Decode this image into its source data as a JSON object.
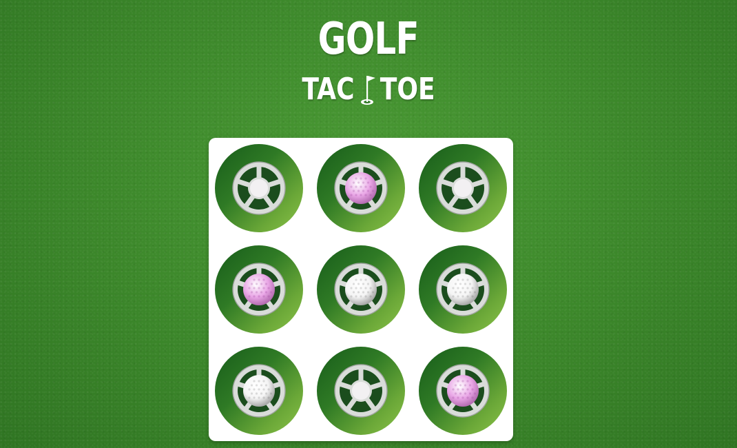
{
  "title": {
    "line1": "GOLF",
    "line2_left": "TAC",
    "line2_right": "TOE"
  },
  "icons": {
    "flag": "golf-flag-hole-icon",
    "cup": "golf-cup-icon",
    "ball": "golf-ball-icon"
  },
  "colors": {
    "board_bg": "#ffffff",
    "cell_dark": "#175c1a",
    "cell_light": "#8cc34a",
    "ball_white": "#f4f4f4",
    "ball_pink": "#e9a6e6"
  },
  "board": {
    "cells": [
      {
        "state": "empty"
      },
      {
        "state": "pink"
      },
      {
        "state": "empty"
      },
      {
        "state": "pink"
      },
      {
        "state": "white"
      },
      {
        "state": "white"
      },
      {
        "state": "white"
      },
      {
        "state": "empty"
      },
      {
        "state": "pink"
      }
    ]
  }
}
